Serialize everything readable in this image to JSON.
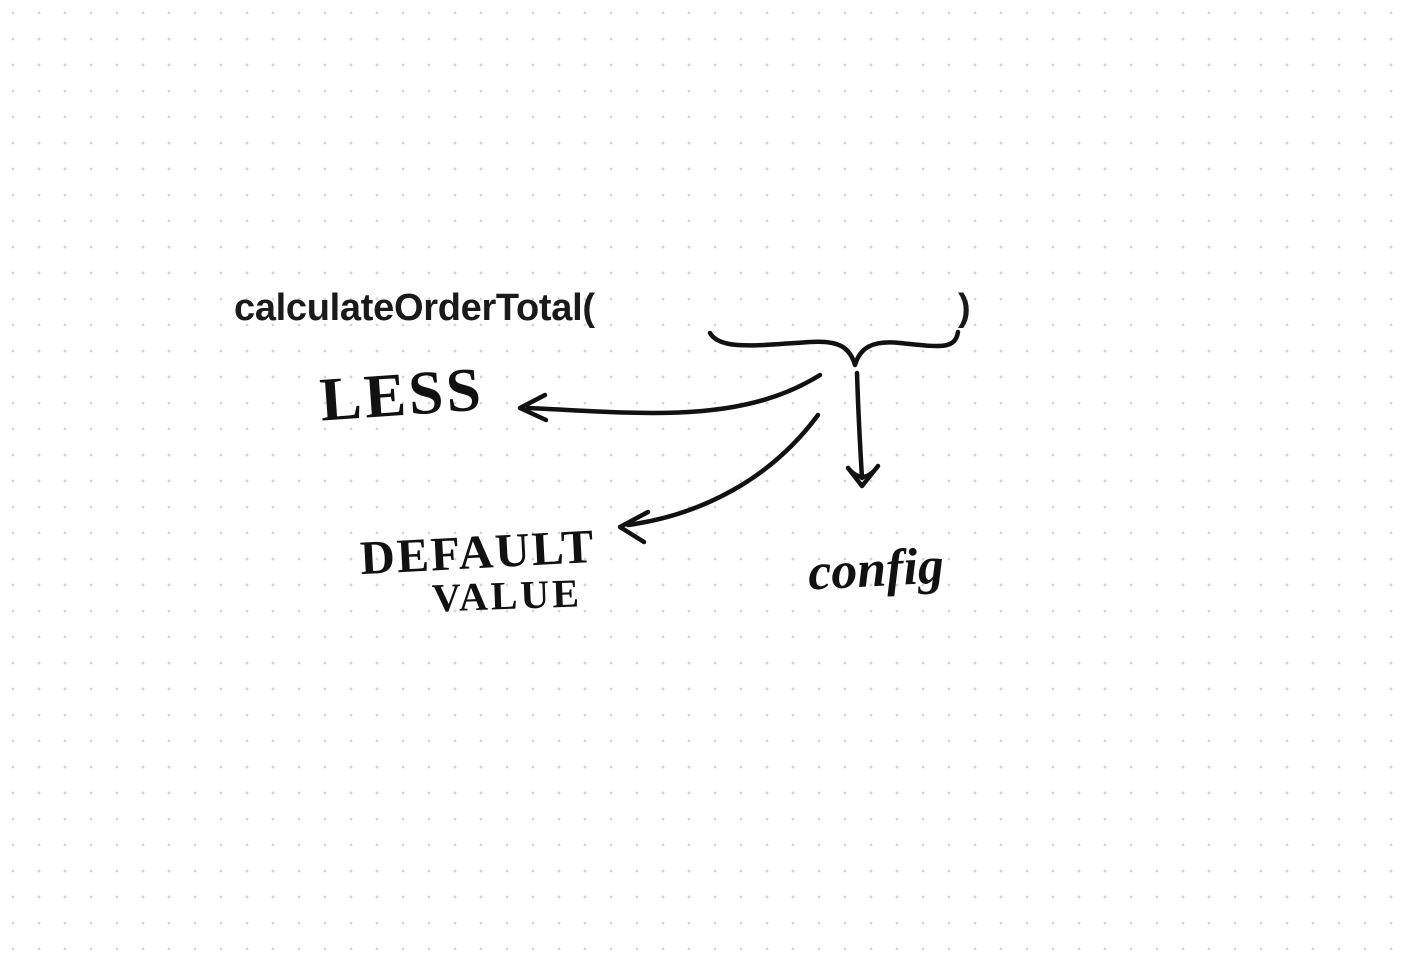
{
  "typed": {
    "func_open": "calculateOrderTotal(",
    "func_close": ")"
  },
  "hand": {
    "less": "LESS",
    "default": "DEFAULT",
    "value": "VALUE",
    "config": "config"
  }
}
